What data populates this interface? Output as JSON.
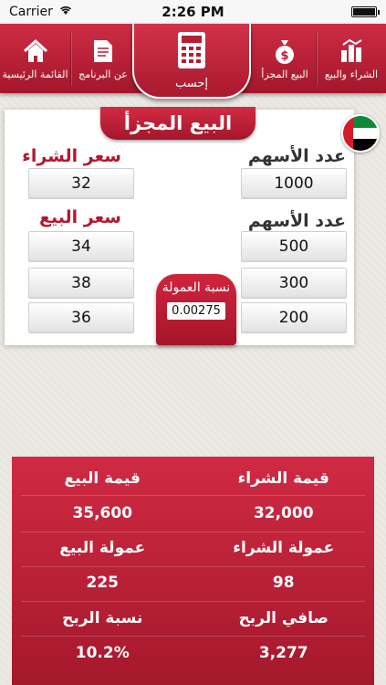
{
  "status": {
    "carrier": "Carrier",
    "time": "2:26 PM",
    "battery_level": 1.0
  },
  "nav": {
    "buy_sell": "الشراء والبيع",
    "partial_sell": "البيع المجزأ",
    "calculate": "إحسب",
    "about": "عن البرنامج",
    "home": "القائمة الرئيسية"
  },
  "card": {
    "title": "البيع المجزأ",
    "buy_price_label": "سعر الشراء",
    "buy_price_value": "32",
    "share_count_label": "عدد الأسهم",
    "share_count_value": "1000",
    "sell_price_label": "سعر البيع",
    "share_count_label_2": "عدد الأسهم",
    "sell_prices": [
      "34",
      "38",
      "36"
    ],
    "sell_shares": [
      "500",
      "300",
      "200"
    ],
    "commission_label": "نسبة العمولة",
    "commission_value": "0.00275"
  },
  "results": {
    "sell_value_label": "قيمة البيع",
    "buy_value_label": "قيمة الشراء",
    "sell_value": "35,600",
    "buy_value": "32,000",
    "sell_commission_label": "عمولة البيع",
    "buy_commission_label": "عمولة الشراء",
    "sell_commission": "225",
    "buy_commission": "98",
    "profit_pct_label": "نسبة الربح",
    "net_profit_label": "صافي الربح",
    "profit_pct": "10.2%",
    "net_profit": "3,277"
  },
  "colors": {
    "brand_red": "#b81d33",
    "flag_red": "#d31c2b",
    "flag_green": "#0c8a3a",
    "flag_black": "#000000"
  },
  "icons": [
    "wifi-icon",
    "battery-icon",
    "buy-sell-icon",
    "money-bag-icon",
    "calculator-icon",
    "document-icon",
    "home-icon"
  ]
}
